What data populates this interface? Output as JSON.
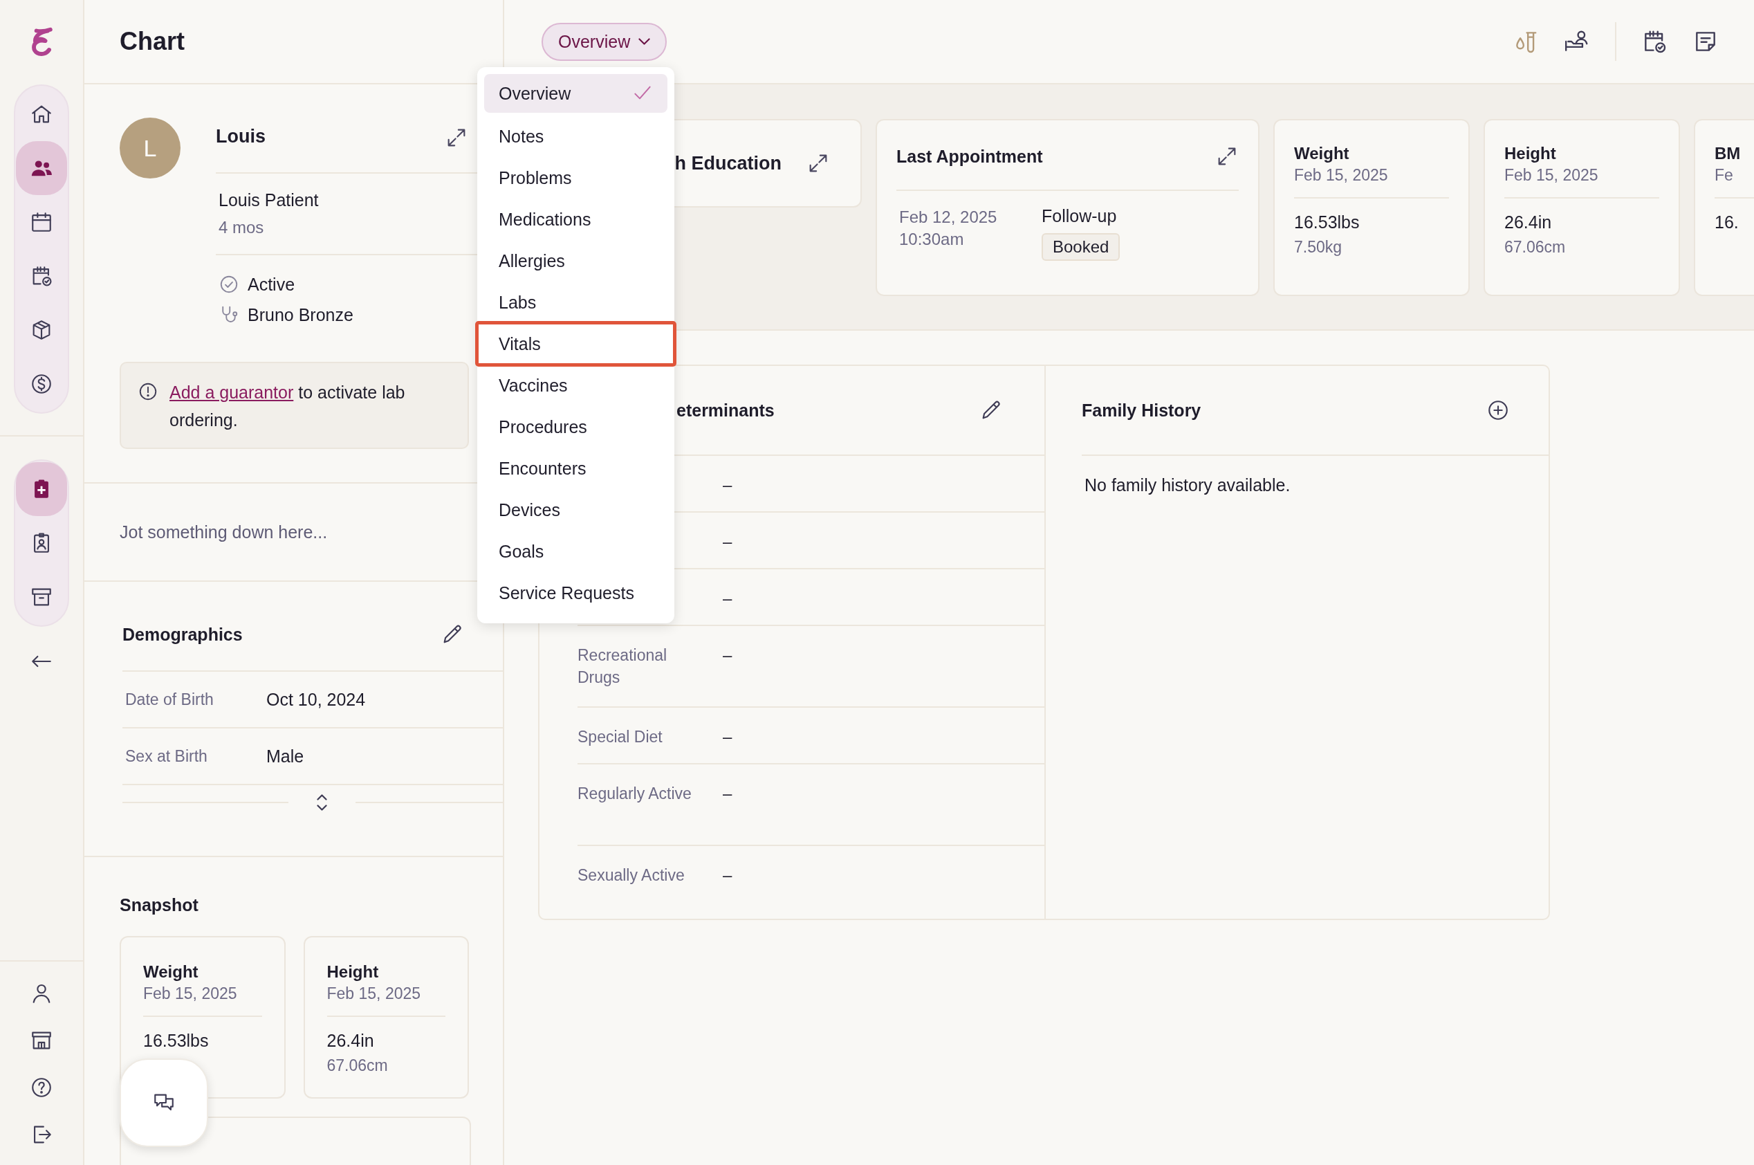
{
  "rail": {
    "primary": [
      {
        "kind": "home",
        "selected": false
      },
      {
        "kind": "patients",
        "selected": true
      },
      {
        "kind": "calendar",
        "selected": false
      },
      {
        "kind": "calendar-check",
        "selected": false
      },
      {
        "kind": "box",
        "selected": false
      },
      {
        "kind": "dollar",
        "selected": false
      }
    ],
    "secondary": [
      {
        "kind": "clipboard",
        "selected": true
      },
      {
        "kind": "badge",
        "selected": false
      },
      {
        "kind": "archive",
        "selected": false
      }
    ],
    "footer": [
      {
        "kind": "person",
        "selected": false
      },
      {
        "kind": "store",
        "selected": false
      },
      {
        "kind": "help",
        "selected": false
      },
      {
        "kind": "logout",
        "selected": false
      }
    ]
  },
  "chart_panel": {
    "title": "Chart",
    "patient": {
      "initial": "L",
      "first_name": "Louis",
      "full_name": "Louis Patient",
      "age": "4 mos",
      "status": "Active",
      "provider": "Bruno Bronze"
    },
    "alert": {
      "link": "Add a guarantor",
      "text": " to activate lab ordering."
    },
    "notes": {
      "placeholder": "Jot something down here..."
    },
    "demographics": {
      "title": "Demographics",
      "rows": [
        {
          "label": "Date of Birth",
          "value": "Oct 10, 2024"
        },
        {
          "label": "Sex at Birth",
          "value": "Male"
        }
      ]
    },
    "snapshot": {
      "title": "Snapshot",
      "cards": [
        {
          "title": "Weight",
          "date": "Feb 15, 2025",
          "value": "16.53lbs"
        },
        {
          "title": "Height",
          "date": "Feb 15, 2025",
          "value": "26.4in",
          "secondary": "67.06cm"
        }
      ]
    }
  },
  "view_menu": {
    "button": "Overview",
    "items": [
      {
        "label": "Overview",
        "selected": true,
        "highlighted": false
      },
      {
        "label": "Notes",
        "selected": false,
        "highlighted": false
      },
      {
        "label": "Problems",
        "selected": false,
        "highlighted": false
      },
      {
        "label": "Medications",
        "selected": false,
        "highlighted": false
      },
      {
        "label": "Allergies",
        "selected": false,
        "highlighted": false
      },
      {
        "label": "Labs",
        "selected": false,
        "highlighted": false
      },
      {
        "label": "Vitals",
        "selected": false,
        "highlighted": true
      },
      {
        "label": "Vaccines",
        "selected": false,
        "highlighted": false
      },
      {
        "label": "Procedures",
        "selected": false,
        "highlighted": false
      },
      {
        "label": "Encounters",
        "selected": false,
        "highlighted": false
      },
      {
        "label": "Devices",
        "selected": false,
        "highlighted": false
      },
      {
        "label": "Goals",
        "selected": false,
        "highlighted": false
      },
      {
        "label": "Service Requests",
        "selected": false,
        "highlighted": false
      }
    ]
  },
  "toolbar": [
    {
      "kind": "lab-tubes"
    },
    {
      "kind": "bed-person"
    },
    {
      "kind": "separator"
    },
    {
      "kind": "calendar-check"
    },
    {
      "kind": "note"
    }
  ],
  "summary_cards": [
    {
      "kind": "education",
      "title": "h Education"
    },
    {
      "kind": "appointment",
      "title": "Last Appointment",
      "date": "Feb 12, 2025",
      "time": "10:30am",
      "type": "Follow-up",
      "status": "Booked"
    },
    {
      "kind": "vital",
      "title": "Weight",
      "date": "Feb 15, 2025",
      "value": "16.53lbs",
      "secondary": "7.50kg"
    },
    {
      "kind": "vital",
      "title": "Height",
      "date": "Feb 15, 2025",
      "value": "26.4in",
      "secondary": "67.06cm"
    },
    {
      "kind": "vital",
      "title": "BM",
      "date": "Fe",
      "value": "16."
    }
  ],
  "social_determinants": {
    "title": "eterminants",
    "rows": [
      {
        "value": "–"
      },
      {
        "value": "–"
      },
      {
        "value": "–"
      },
      {
        "label": "Recreational Drugs",
        "value": "–"
      },
      {
        "label": "Special Diet",
        "value": "–"
      },
      {
        "label": "Regularly Active",
        "value": "–"
      },
      {
        "label": "Sexually Active",
        "value": "–"
      }
    ]
  },
  "family_history": {
    "title": "Family History",
    "empty_text": "No family history available."
  }
}
